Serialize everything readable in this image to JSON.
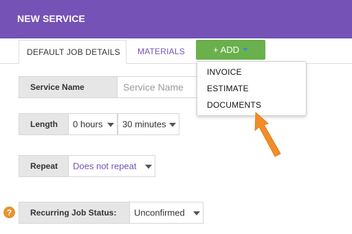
{
  "header": {
    "title": "NEW SERVICE"
  },
  "tabs": [
    {
      "label": "DEFAULT JOB DETAILS"
    },
    {
      "label": "MATERIALS"
    }
  ],
  "add_button": {
    "label": "+ ADD",
    "icon": "caret-down-icon"
  },
  "add_menu": {
    "items": [
      {
        "label": "INVOICE"
      },
      {
        "label": "ESTIMATE"
      },
      {
        "label": "DOCUMENTS"
      }
    ]
  },
  "form": {
    "service_name": {
      "label": "Service Name",
      "placeholder": "Service Name"
    },
    "length": {
      "label": "Length",
      "hours": "0 hours",
      "minutes": "30 minutes"
    },
    "repeat": {
      "label": "Repeat",
      "value": "Does not repeat"
    },
    "recurring_status": {
      "label": "Recurring Job Status:",
      "value": "Unconfirmed"
    }
  },
  "help_icon": {
    "glyph": "?"
  },
  "colors": {
    "header_bg": "#7452b6",
    "add_button_bg": "#6ab04c",
    "accent_text": "#7452b6",
    "arrow": "#f28c28",
    "help_icon": "#e6952e"
  }
}
